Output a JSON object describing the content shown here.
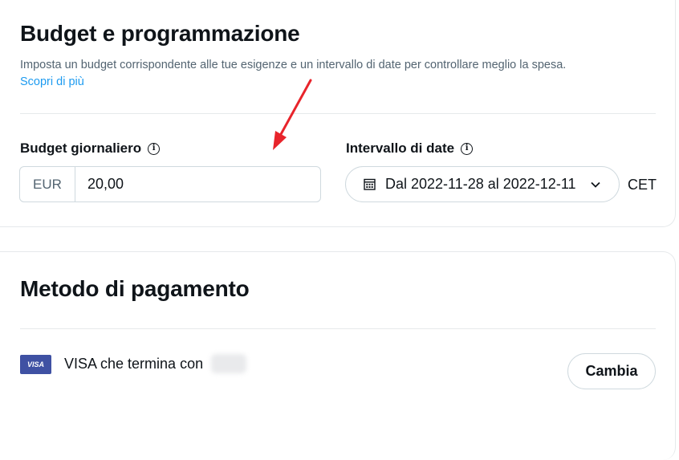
{
  "budget_section": {
    "title": "Budget e programmazione",
    "description": "Imposta un budget corrispondente alle tue esigenze e un intervallo di date per controllare meglio la spesa.",
    "learn_more": "Scopri di più",
    "daily_budget": {
      "label": "Budget giornaliero",
      "info_icon": "info-icon",
      "currency": "EUR",
      "value": "20,00"
    },
    "date_range": {
      "label": "Intervallo di date",
      "info_icon": "info-icon",
      "value": "Dal 2022-11-28 al 2022-12-11",
      "calendar_icon": "calendar-icon",
      "chevron_icon": "chevron-down-icon",
      "timezone": "CET"
    }
  },
  "payment_section": {
    "title": "Metodo di pagamento",
    "card_brand": "VISA",
    "card_text": "VISA che termina con",
    "change_button": "Cambia"
  },
  "colors": {
    "link": "#1d9bf0",
    "annotation_arrow": "#e8242b",
    "visa_badge": "#3f51a3",
    "border": "#cfd9de"
  }
}
